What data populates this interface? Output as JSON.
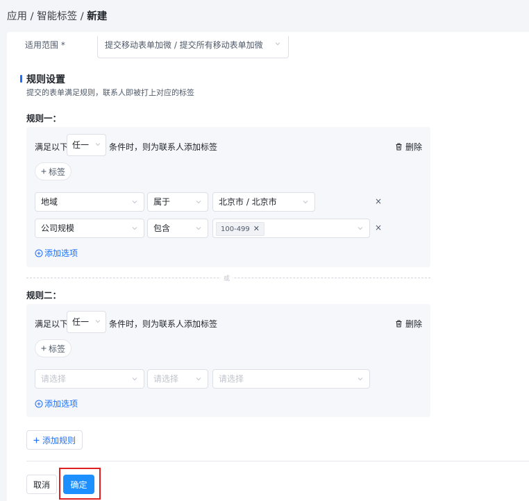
{
  "breadcrumb": {
    "path": "应用 / 智能标签 / ",
    "current": "新建"
  },
  "scope": {
    "label": "适用范围 *",
    "value": "提交移动表单加微 / 提交所有移动表单加微"
  },
  "section": {
    "title": "规则设置",
    "desc": "提交的表单满足规则，联系人即被打上对应的标签"
  },
  "rules": [
    {
      "title": "规则一：",
      "cond_prefix": "满足以下",
      "match_mode": "任一",
      "cond_suffix": "条件时，则为联系人添加标签",
      "delete_label": "删除",
      "tag_button": "标签",
      "conditions": [
        {
          "field": "地域",
          "operator": "属于",
          "value": "北京市 / 北京市",
          "remove": "×"
        },
        {
          "field": "公司规模",
          "operator": "包含",
          "value_chip": "100-499",
          "remove": "×"
        }
      ],
      "add_option": "添加选项"
    },
    {
      "title": "规则二：",
      "cond_prefix": "满足以下",
      "match_mode": "任一",
      "cond_suffix": "条件时，则为联系人添加标签",
      "delete_label": "删除",
      "tag_button": "标签",
      "conditions": [
        {
          "field_placeholder": "请选择",
          "operator_placeholder": "请选择",
          "value_placeholder": "请选择"
        }
      ],
      "add_option": "添加选项"
    }
  ],
  "divider_text": "或",
  "add_rule": "添加规则",
  "footer": {
    "cancel": "取消",
    "confirm": "确定"
  },
  "colors": {
    "primary": "#1e6fff",
    "confirm_bg": "#1e8fff",
    "highlight": "#e02020",
    "rule_bg": "#f5f7fa"
  }
}
